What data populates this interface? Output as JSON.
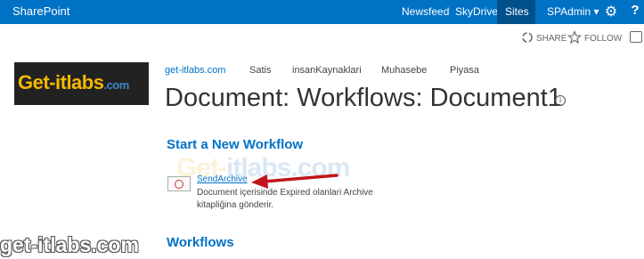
{
  "suitebar": {
    "brand": "SharePoint",
    "links": [
      "Newsfeed",
      "SkyDrive",
      "Sites"
    ],
    "user": "SPAdmin",
    "user_caret": "▾",
    "gear_glyph": "⚙",
    "help_glyph": "?"
  },
  "actions": {
    "share": "SHARE",
    "follow": "FOLLOW"
  },
  "logo": {
    "text_main": "Get-itlabs",
    "text_small": ".com"
  },
  "topnav": [
    "get-itlabs.com",
    "Satis",
    "insanKaynaklari",
    "Muhasebe",
    "Piyasa"
  ],
  "page": {
    "title": "Document: Workflows: Document1",
    "info_glyph": "i"
  },
  "start_section": {
    "title": "Start a New Workflow",
    "workflow": {
      "name": "SendArchive",
      "description": "Document içerisinde Expired olanlari Archive kitapliğina gönderir."
    }
  },
  "workflows_section": {
    "title": "Workflows"
  },
  "watermark": {
    "part1": "Get-",
    "part2": "itlabs",
    "part3": ".com",
    "bottom": "get-itlabs.com"
  },
  "colors": {
    "suitebar": "#0072c6",
    "accent": "#0072c6",
    "arrow": "#c0161b"
  },
  "icons": {
    "share": "share-icon",
    "follow": "star-icon",
    "focus": "focus-icon",
    "settings": "gear-icon",
    "help": "help-icon",
    "info": "info-icon",
    "workflow": "workflow-start-icon"
  }
}
